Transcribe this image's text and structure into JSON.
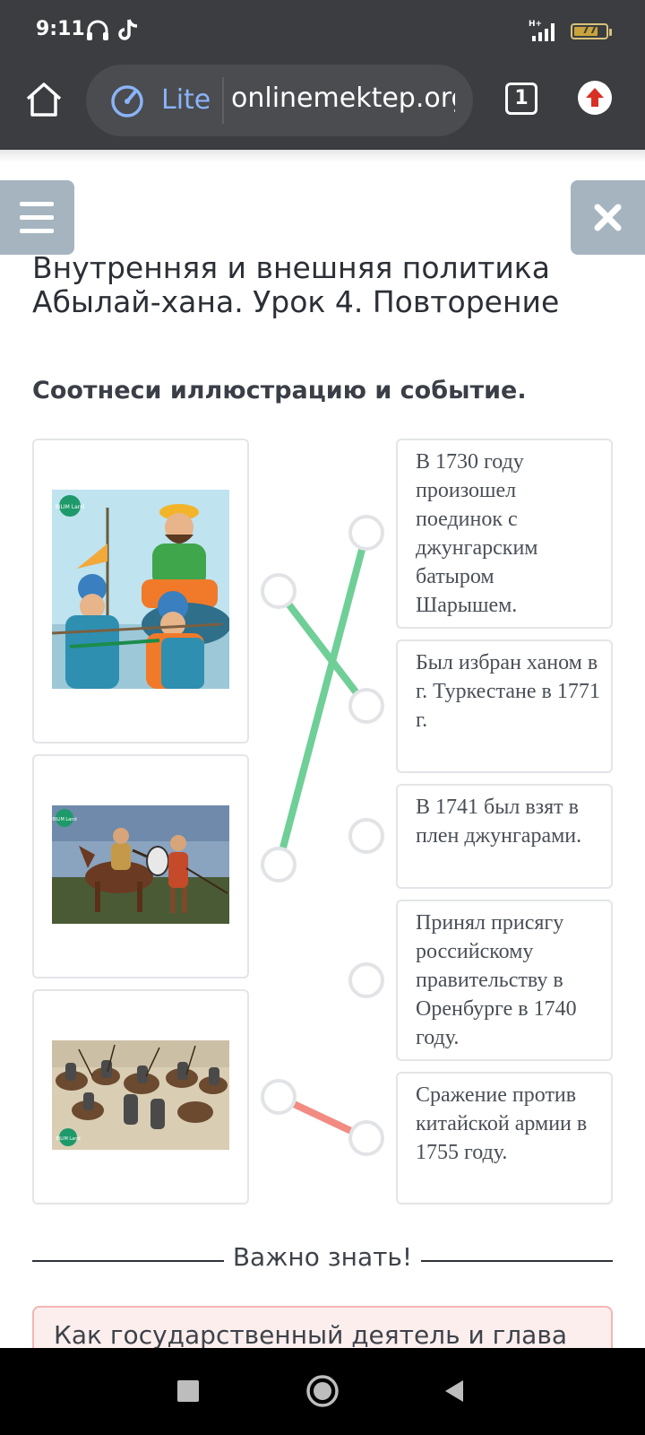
{
  "status_bar": {
    "time": "9:11",
    "network": "H+",
    "battery_level": "77",
    "battery_fraction": 0.77
  },
  "browser": {
    "mode_label": "Lite",
    "url": "onlinemektep.org",
    "tab_count": "1"
  },
  "lesson": {
    "title": "Внутренняя и внешняя политика Абылай-хана. Урок 4. Повторение",
    "instruction": "Соотнеси иллюстрацию и событие."
  },
  "matching": {
    "images": [
      {
        "label": "Абылай-хан на коне среди воинов",
        "logo": "BILIM Land"
      },
      {
        "label": "Поединок всадника и воина",
        "logo": "BILIM Land"
      },
      {
        "label": "Сражение армий",
        "logo": "BILIM Land"
      }
    ],
    "events": [
      "В 1730 году произошел поединок с джунгарским батыром Шарышем.",
      "Был избран ханом в г. Туркестане в 1771 г.",
      "В 1741 был взят в плен джунгарами.",
      "Принял присягу российскому правительству в Оренбурге в 1740 году.",
      "Сражение против китайской армии в 1755 году."
    ],
    "connections": [
      {
        "image": 1,
        "event": 2,
        "color": "#6fcf97"
      },
      {
        "image": 2,
        "event": 1,
        "color": "#6fcf97"
      },
      {
        "image": 3,
        "event": 5,
        "color": "#f28b82"
      }
    ]
  },
  "important": {
    "heading": "Важно знать!",
    "text": "Как государственный деятель и глава"
  },
  "colors": {
    "browser_bar": "#3b3d40",
    "correct_line": "#6fcf97",
    "wrong_line": "#f28b82",
    "side_button": "#a5b4bf"
  }
}
